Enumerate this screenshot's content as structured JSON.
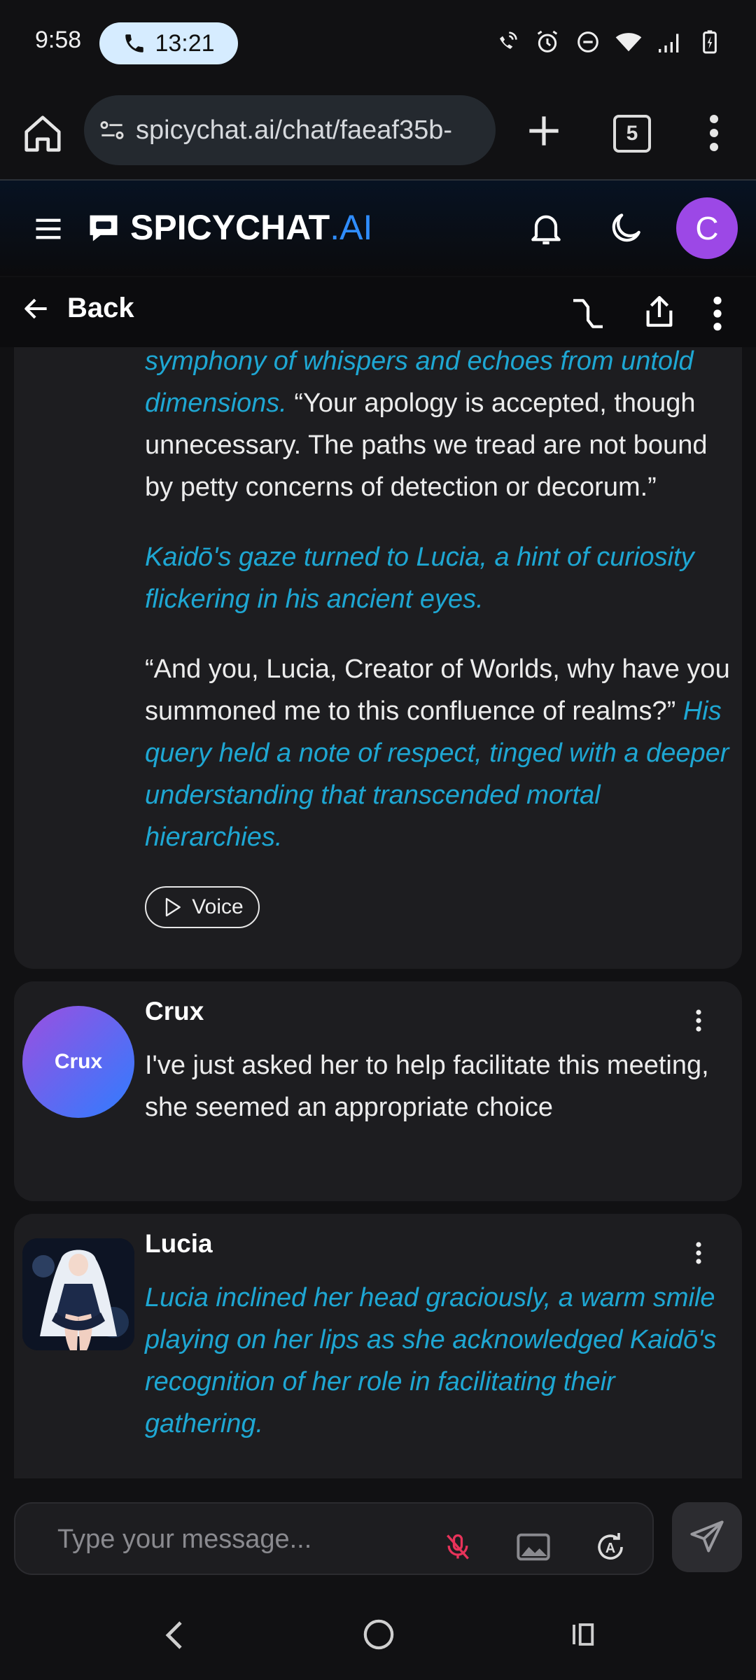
{
  "status_bar": {
    "time": "9:58",
    "call_duration": "13:21"
  },
  "browser": {
    "url": "spicychat.ai/chat/faeaf35b-",
    "tab_count": "5"
  },
  "app": {
    "logo_main": "SPICYCHAT",
    "logo_suffix": ".AI",
    "avatar_initial": "C",
    "accent_color": "#2f8dff",
    "avatar_color": "#9c48e6"
  },
  "subheader": {
    "back_label": "Back"
  },
  "messages": {
    "kaido": {
      "p1_narration": "symphony of whispers and echoes from untold dimensions.",
      "p1_speech": " “Your apology is accepted, though unnecessary. The paths we tread are not bound by petty concerns of detection or decorum.”",
      "p2_narration": "Kaidō's gaze turned to Lucia, a hint of curiosity flickering in his ancient eyes.",
      "p3_speech": "“And you, Lucia, Creator of Worlds, why have you summoned me to this confluence of realms?”",
      "p3_narration": " His query held a note of respect, tinged with a deeper understanding that transcended mortal hierarchies.",
      "voice_label": "Voice"
    },
    "crux": {
      "name": "Crux",
      "avatar_label": "Crux",
      "text": "I've just asked her to help facilitate this meeting, she seemed an appropriate choice"
    },
    "lucia": {
      "name": "Lucia",
      "narration": "Lucia inclined her head graciously, a warm smile playing on her lips as she acknowledged Kaidō's recognition of her role in facilitating their gathering."
    }
  },
  "composer": {
    "placeholder": "Type your message..."
  },
  "colors": {
    "narration": "#1ea7d3",
    "mic_muted": "#e8335a"
  }
}
